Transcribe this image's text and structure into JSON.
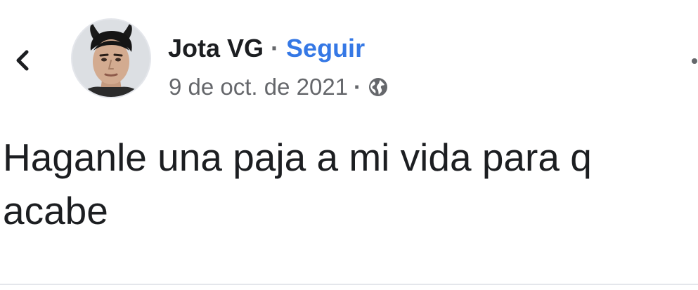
{
  "post": {
    "author": {
      "name": "Jota VG",
      "separator": "·",
      "follow_label": "Seguir"
    },
    "meta": {
      "date": "9 de oct. de 2021",
      "separator": "·",
      "audience_icon": "globe-icon"
    },
    "text": "Haganle una paja a mi vida para q acabe"
  },
  "icons": {
    "back": "chevron-left-icon",
    "more": "more-options-icon"
  },
  "colors": {
    "link": "#3578e5",
    "secondary_text": "#65676b",
    "primary_text": "#1c1e21"
  }
}
